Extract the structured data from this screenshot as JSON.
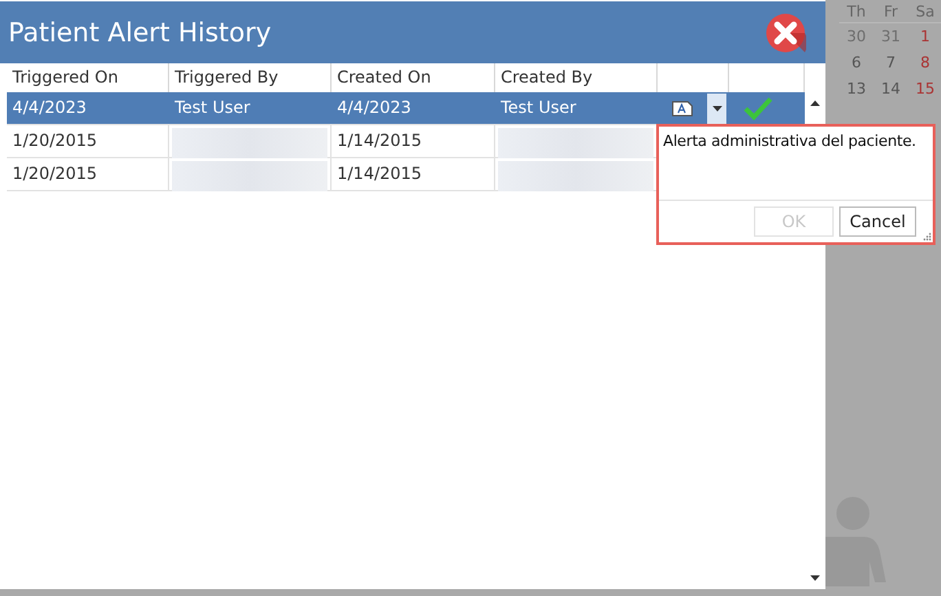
{
  "dialog": {
    "title": "Patient Alert History"
  },
  "table": {
    "columns": [
      "Triggered On",
      "Triggered By",
      "Created On",
      "Created By"
    ],
    "rows": [
      {
        "triggered_on": "4/4/2023",
        "triggered_by": "Test User",
        "created_on": "4/4/2023",
        "created_by": "Test User",
        "selected": true
      },
      {
        "triggered_on": "1/20/2015",
        "created_on": "1/14/2015",
        "selected": false
      },
      {
        "triggered_on": "1/20/2015",
        "created_on": "1/14/2015",
        "selected": false
      }
    ]
  },
  "note_popup": {
    "text": "Alerta administrativa del paciente.",
    "buttons": [
      {
        "label": "OK",
        "disabled": true
      },
      {
        "label": "Cancel",
        "disabled": false
      }
    ]
  },
  "calendar": {
    "weekdays": [
      "Th",
      "Fr",
      "Sa"
    ],
    "weeks": [
      [
        {
          "day": "30",
          "kind": "other"
        },
        {
          "day": "31",
          "kind": "other"
        },
        {
          "day": "1",
          "kind": "weekend"
        }
      ],
      [
        {
          "day": "6",
          "kind": "day"
        },
        {
          "day": "7",
          "kind": "day"
        },
        {
          "day": "8",
          "kind": "weekend"
        }
      ],
      [
        {
          "day": "13",
          "kind": "day"
        },
        {
          "day": "14",
          "kind": "day"
        },
        {
          "day": "15",
          "kind": "weekend"
        }
      ]
    ]
  }
}
